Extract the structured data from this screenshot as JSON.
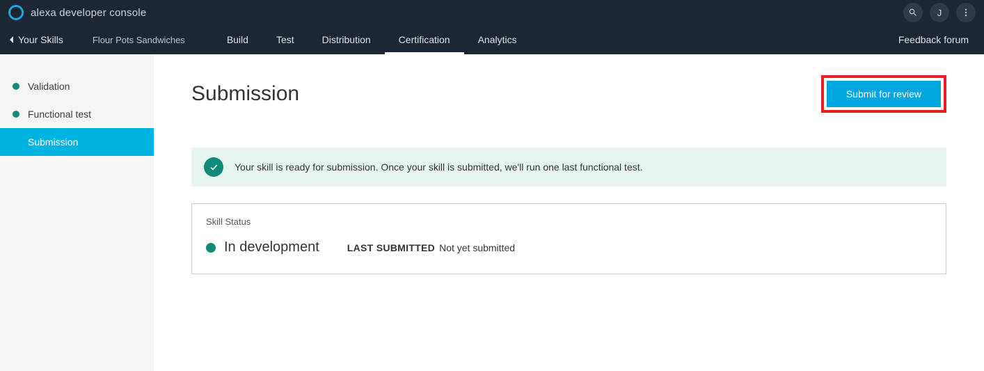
{
  "header": {
    "app_title": "alexa developer console",
    "avatar_initial": "J"
  },
  "nav": {
    "back_label": "Your Skills",
    "skill_name": "Flour Pots Sandwiches",
    "tabs": [
      {
        "label": "Build",
        "active": false
      },
      {
        "label": "Test",
        "active": false
      },
      {
        "label": "Distribution",
        "active": false
      },
      {
        "label": "Certification",
        "active": true
      },
      {
        "label": "Analytics",
        "active": false
      }
    ],
    "feedback_label": "Feedback forum"
  },
  "sidebar": {
    "items": [
      {
        "label": "Validation",
        "active": false
      },
      {
        "label": "Functional test",
        "active": false
      },
      {
        "label": "Submission",
        "active": true
      }
    ]
  },
  "page": {
    "title": "Submission",
    "submit_button": "Submit for review",
    "alert_text": "Your skill is ready for submission. Once your skill is submitted, we'll run one last functional test.",
    "card": {
      "label": "Skill Status",
      "status_value": "In development",
      "last_submitted_label": "LAST SUBMITTED",
      "last_submitted_value": "Not yet submitted"
    }
  }
}
